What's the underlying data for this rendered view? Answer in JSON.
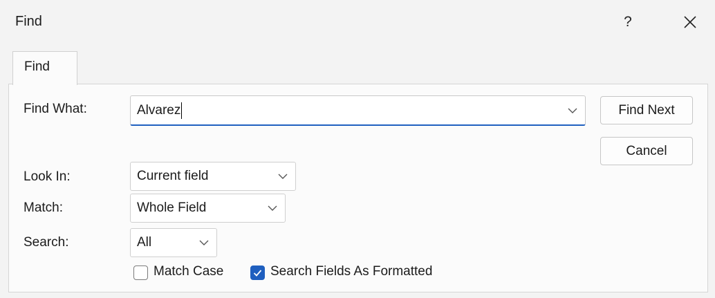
{
  "window": {
    "title": "Find",
    "help_label": "?"
  },
  "tabs": [
    {
      "label": "Find",
      "active": true
    }
  ],
  "find_what": {
    "label": "Find What:",
    "value": "Alvarez"
  },
  "buttons": {
    "find_next": "Find Next",
    "cancel": "Cancel"
  },
  "look_in": {
    "label": "Look In:",
    "value": "Current field"
  },
  "match": {
    "label": "Match:",
    "value": "Whole Field"
  },
  "search": {
    "label": "Search:",
    "value": "All"
  },
  "options": {
    "match_case": {
      "label": "Match Case",
      "checked": false
    },
    "search_fields_as_formatted": {
      "label": "Search Fields As Formatted",
      "checked": true
    }
  },
  "colors": {
    "accent": "#1f5fbf",
    "background": "#f3f3f3",
    "panel": "#fbfbfb"
  },
  "icons": {
    "close": "close-icon",
    "dropdown": "chevron-down-icon",
    "check": "checkmark-icon"
  }
}
